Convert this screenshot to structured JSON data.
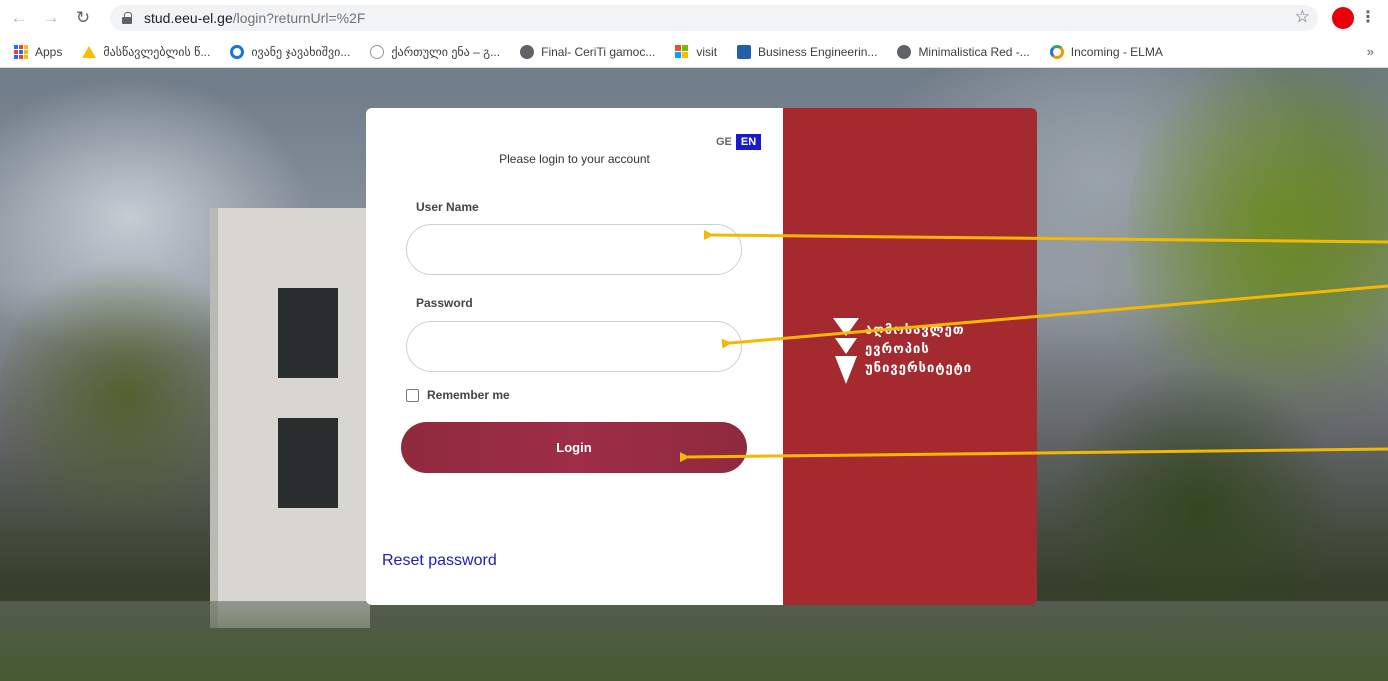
{
  "browser": {
    "url_host": "stud.eeu-el.ge",
    "url_path": "/login?returnUrl=%2F",
    "bookmarks": [
      {
        "label": "Apps",
        "icon": "apps-grid-icon"
      },
      {
        "label": "მასწავლებლის წ...",
        "icon": "google-drive-icon"
      },
      {
        "label": "ივანე ჯავახიშვი...",
        "icon": "ring-logo-icon"
      },
      {
        "label": "ქართული ენა – გ...",
        "icon": "site-favicon-icon"
      },
      {
        "label": "Final- CeriTi gamoc...",
        "icon": "globe-icon"
      },
      {
        "label": "visit",
        "icon": "windows-grid-icon"
      },
      {
        "label": "Business Engineerin...",
        "icon": "business-icon"
      },
      {
        "label": "Minimalistica Red -...",
        "icon": "globe-icon"
      },
      {
        "label": "Incoming - ELMA",
        "icon": "elma-icon"
      }
    ],
    "more_label": "»"
  },
  "login": {
    "lang_ge": "GE",
    "lang_en": "EN",
    "heading": "Please login to your account",
    "username_label": "User Name",
    "username_value": "",
    "password_label": "Password",
    "password_value": "",
    "remember_label": "Remember me",
    "remember_checked": false,
    "login_button": "Login",
    "reset_link": "Reset password"
  },
  "brand": {
    "logo_lines": [
      "აღმოსავლეთ",
      "ევროპის",
      "უნივერსიტეტი"
    ],
    "panel_color": "#a52a2f"
  },
  "colors": {
    "accent": "#1a1acd",
    "login_button": "#9e2d48",
    "annotation_arrow": "#f5b800"
  }
}
